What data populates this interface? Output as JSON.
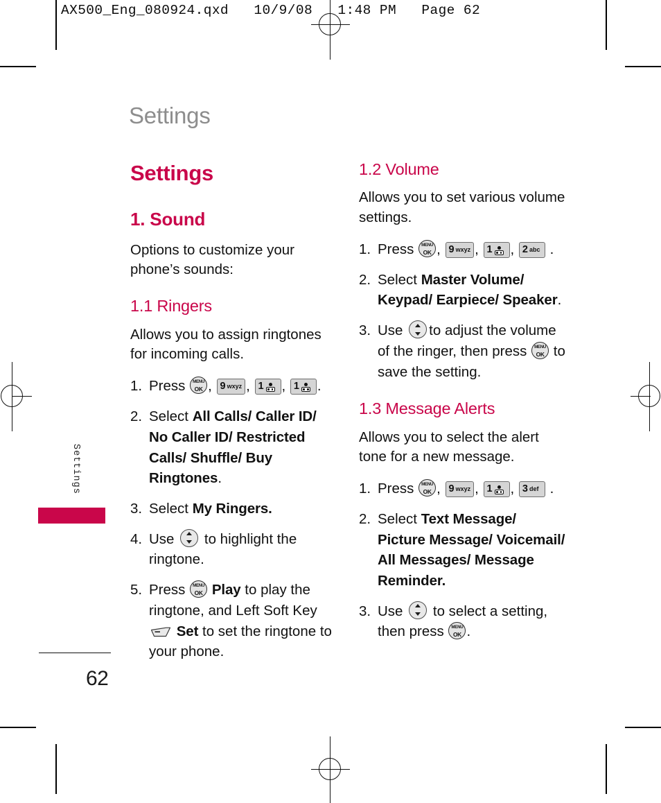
{
  "prepress": {
    "slug": "AX500_Eng_080924.qxd   10/9/08   1:48 PM   Page 62"
  },
  "page": {
    "running_head": "Settings",
    "thumb_tab_label": "Settings",
    "thumb_tab_color": "#c9064a",
    "accent_color": "#c9064a",
    "page_number": "62"
  },
  "left_column": {
    "doc_title": "Settings",
    "section": {
      "title": "1. Sound",
      "intro": "Options to customize your phone’s sounds:"
    },
    "subsection": {
      "title": "1.1 Ringers",
      "intro": "Allows you to assign ringtones for incoming calls.",
      "steps": [
        {
          "num": "1.",
          "lead": "Press",
          "keys": [
            "menu-ok",
            "9-wxyz",
            "1-voicemail",
            "1-voicemail"
          ],
          "trail": "."
        },
        {
          "num": "2.",
          "lead": "Select",
          "bold": "All Calls/ Caller ID/ No Caller ID/ Restricted Calls/ Shuffle/ Buy Ringtones",
          "trail": "."
        },
        {
          "num": "3.",
          "lead": "Select",
          "bold": "My Ringers.",
          "trail": ""
        },
        {
          "num": "4.",
          "lead": "Use",
          "key": "nav-updown",
          "trail": "to highlight the ringtone."
        },
        {
          "num": "5.",
          "lead": "Press",
          "key": "menu-ok",
          "bold_a": "Play",
          "mid": "to play the ringtone, and Left Soft Key",
          "key_b": "left-soft-key",
          "bold_b": "Set",
          "trail": "to set the ringtone to your phone."
        }
      ]
    }
  },
  "right_column": {
    "sections": [
      {
        "title": "1.2 Volume",
        "intro": "Allows you to set various volume settings.",
        "steps": [
          {
            "num": "1.",
            "lead": "Press",
            "keys": [
              "menu-ok",
              "9-wxyz",
              "1-voicemail",
              "2-abc"
            ],
            "trail": "."
          },
          {
            "num": "2.",
            "lead": "Select",
            "bold": "Master Volume/ Keypad/ Earpiece/ Speaker",
            "trail": "."
          },
          {
            "num": "3.",
            "lead": "Use",
            "key": "nav-updown",
            "mid": "to adjust the volume of the ringer, then press",
            "key_b": "menu-ok",
            "trail": "to save the setting."
          }
        ]
      },
      {
        "title": "1.3 Message Alerts",
        "intro": "Allows you to select the alert tone for a new message.",
        "steps": [
          {
            "num": "1.",
            "lead": "Press",
            "keys": [
              "menu-ok",
              "9-wxyz",
              "1-voicemail",
              "3-def"
            ],
            "trail": "."
          },
          {
            "num": "2.",
            "lead": "Select",
            "bold": "Text Message/ Picture Message/ Voicemail/ All Messages/ Message Reminder.",
            "trail": ""
          },
          {
            "num": "3.",
            "lead": "Use",
            "key": "nav-updown",
            "mid": "to select a setting, then press",
            "key_b": "menu-ok",
            "trail": "."
          }
        ]
      }
    ]
  },
  "keys": {
    "menu_ok": {
      "line1": "MENU",
      "line2": "OK"
    },
    "nine": {
      "digit": "9",
      "letters": "wxyz"
    },
    "two": {
      "digit": "2",
      "letters": "abc"
    },
    "three": {
      "digit": "3",
      "letters": "def"
    },
    "one": {
      "digit": "1",
      "letters": ""
    }
  }
}
